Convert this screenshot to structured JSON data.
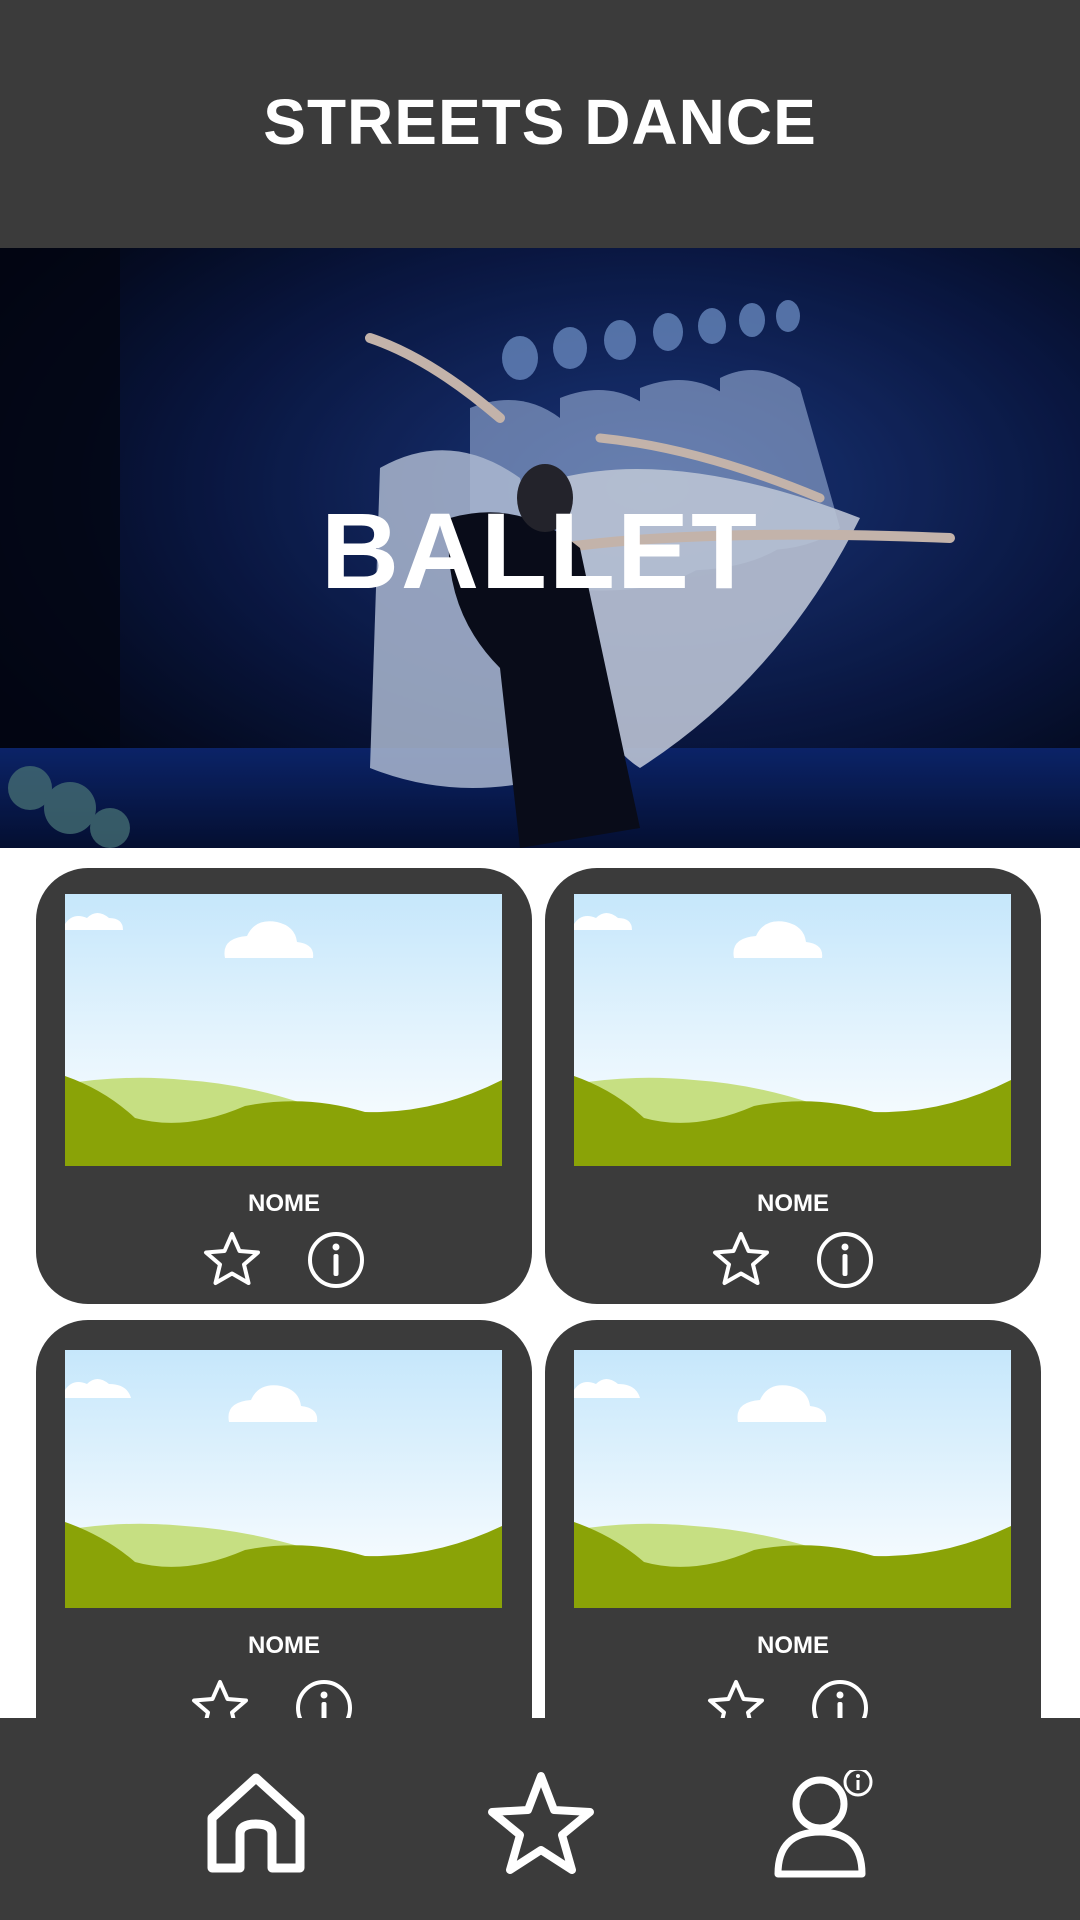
{
  "app": {
    "title": "STREETS DANCE"
  },
  "hero": {
    "title": "BALLET"
  },
  "cards": [
    {
      "name": "NOME",
      "favorite_icon": "star-icon",
      "info_icon": "info-icon"
    },
    {
      "name": "NOME",
      "favorite_icon": "star-icon",
      "info_icon": "info-icon"
    },
    {
      "name": "NOME",
      "favorite_icon": "star-icon",
      "info_icon": "info-icon"
    },
    {
      "name": "NOME",
      "favorite_icon": "star-icon",
      "info_icon": "info-icon"
    }
  ],
  "bottom_nav": {
    "items": [
      {
        "icon": "home-icon"
      },
      {
        "icon": "star-icon"
      },
      {
        "icon": "user-info-icon"
      }
    ]
  },
  "colors": {
    "bar": "#3b3b3b",
    "background": "#ffffff",
    "sky": "#c9e9fb",
    "hill_dark": "#8aa307",
    "hill_light": "#c6df82"
  }
}
